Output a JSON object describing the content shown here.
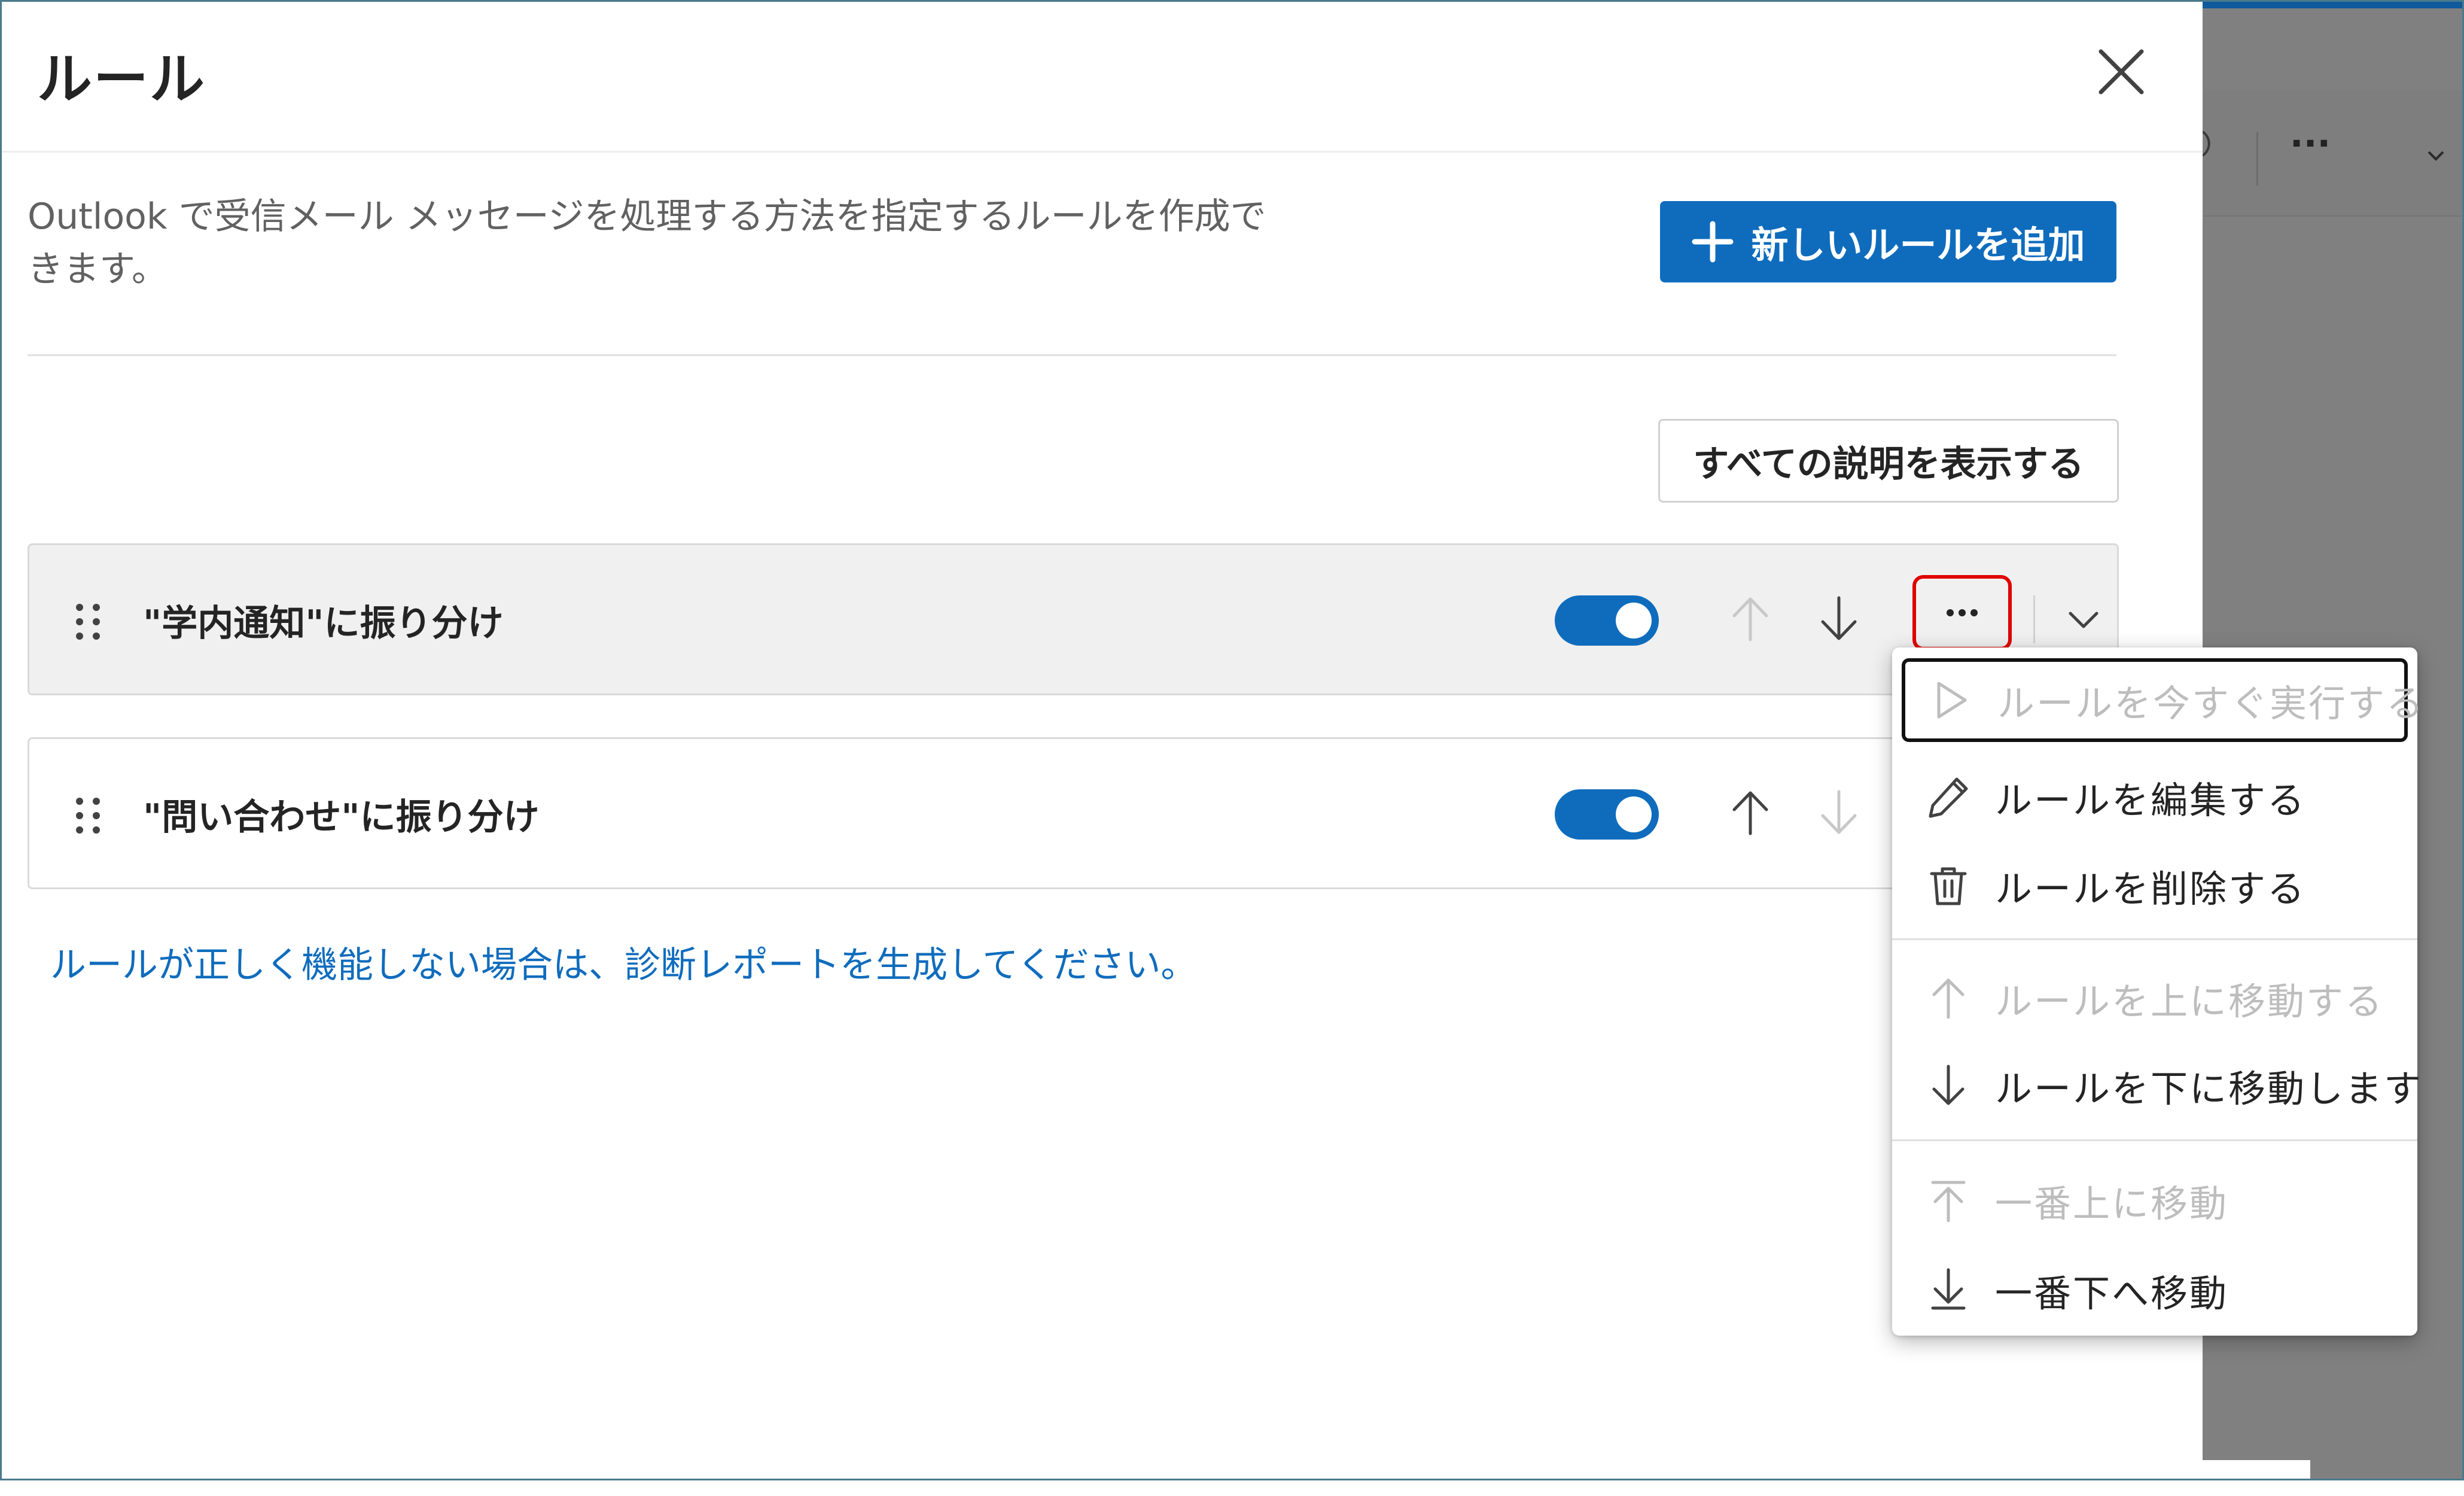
{
  "dialog": {
    "title": "ルール",
    "description": "Outlook で受信メール メッセージを処理する方法を指定するルールを作成できます。",
    "add_rule_label": "新しいルールを追加",
    "show_all_descriptions_label": "すべての説明を表示する",
    "diagnostic_link": "ルールが正しく機能しない場合は、診断レポートを生成してください。"
  },
  "rules": [
    {
      "name": "\"学内通知\"に振り分け",
      "enabled": true,
      "move_up_enabled": false,
      "move_down_enabled": true
    },
    {
      "name": "\"問い合わせ\"に振り分け",
      "enabled": true,
      "move_up_enabled": true,
      "move_down_enabled": false
    }
  ],
  "context_menu": {
    "items": [
      {
        "label": "ルールを今すぐ実行する",
        "icon": "play-icon",
        "disabled": true,
        "focused": true
      },
      {
        "label": "ルールを編集する",
        "icon": "pencil-icon",
        "disabled": false
      },
      {
        "label": "ルールを削除する",
        "icon": "trash-icon",
        "disabled": false
      },
      {
        "label": "ルールを上に移動する",
        "icon": "arrow-up-icon",
        "disabled": true
      },
      {
        "label": "ルールを下に移動します",
        "icon": "arrow-down-icon",
        "disabled": false
      },
      {
        "label": "一番上に移動",
        "icon": "arrow-to-top-icon",
        "disabled": true
      },
      {
        "label": "一番下へ移動",
        "icon": "arrow-to-bottom-icon",
        "disabled": false
      }
    ]
  },
  "background": {
    "more_label": "···"
  },
  "colors": {
    "accent": "#0f6cbd",
    "highlight_box": "#e00000",
    "disabled_text": "#bdbdbd"
  }
}
